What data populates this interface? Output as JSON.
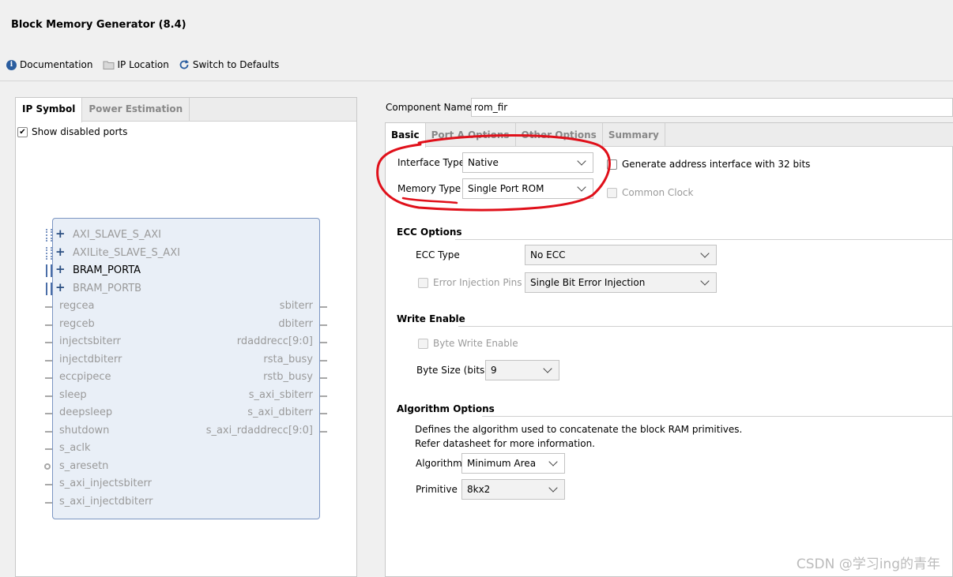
{
  "window": {
    "title": "Block Memory Generator (8.4)"
  },
  "toolbar": {
    "documentation": "Documentation",
    "ip_location": "IP Location",
    "switch_defaults": "Switch to Defaults"
  },
  "left": {
    "tabs": [
      "IP Symbol",
      "Power Estimation"
    ],
    "show_disabled_ports": "Show disabled ports",
    "buses": [
      "AXI_SLAVE_S_AXI",
      "AXILite_SLAVE_S_AXI",
      "BRAM_PORTA",
      "BRAM_PORTB"
    ],
    "left_ports": [
      "regcea",
      "regceb",
      "injectsbiterr",
      "injectdbiterr",
      "eccpipece",
      "sleep",
      "deepsleep",
      "shutdown",
      "s_aclk",
      "s_aresetn",
      "s_axi_injectsbiterr",
      "s_axi_injectdbiterr"
    ],
    "right_ports": [
      "sbiterr",
      "dbiterr",
      "rdaddrecc[9:0]",
      "rsta_busy",
      "rstb_busy",
      "s_axi_sbiterr",
      "s_axi_dbiterr",
      "s_axi_rdaddrecc[9:0]"
    ]
  },
  "right": {
    "component_name_label": "Component Name",
    "component_name_value": "rom_fir",
    "tabs": [
      "Basic",
      "Port A Options",
      "Other Options",
      "Summary"
    ],
    "interface_type_label": "Interface Type",
    "interface_type_value": "Native",
    "memory_type_label": "Memory Type",
    "memory_type_value": "Single Port ROM",
    "gen_addr_label": "Generate address interface with 32 bits",
    "common_clock_label": "Common Clock",
    "ecc_section": "ECC Options",
    "ecc_type_label": "ECC Type",
    "ecc_type_value": "No ECC",
    "error_injection_label": "Error Injection Pins",
    "error_injection_value": "Single Bit Error Injection",
    "write_enable_section": "Write Enable",
    "byte_write_enable_label": "Byte Write Enable",
    "byte_size_label": "Byte Size (bits)",
    "byte_size_value": "9",
    "algorithm_section": "Algorithm Options",
    "algo_desc1": "Defines the algorithm used to concatenate the block RAM primitives.",
    "algo_desc2": "Refer datasheet for more information.",
    "algorithm_label": "Algorithm",
    "algorithm_value": "Minimum Area",
    "primitive_label": "Primitive",
    "primitive_value": "8kx2"
  },
  "watermark": "CSDN @学习ing的青年",
  "colors": {
    "annotation_red": "#e0101a",
    "symbol_border": "#7b95c2"
  }
}
